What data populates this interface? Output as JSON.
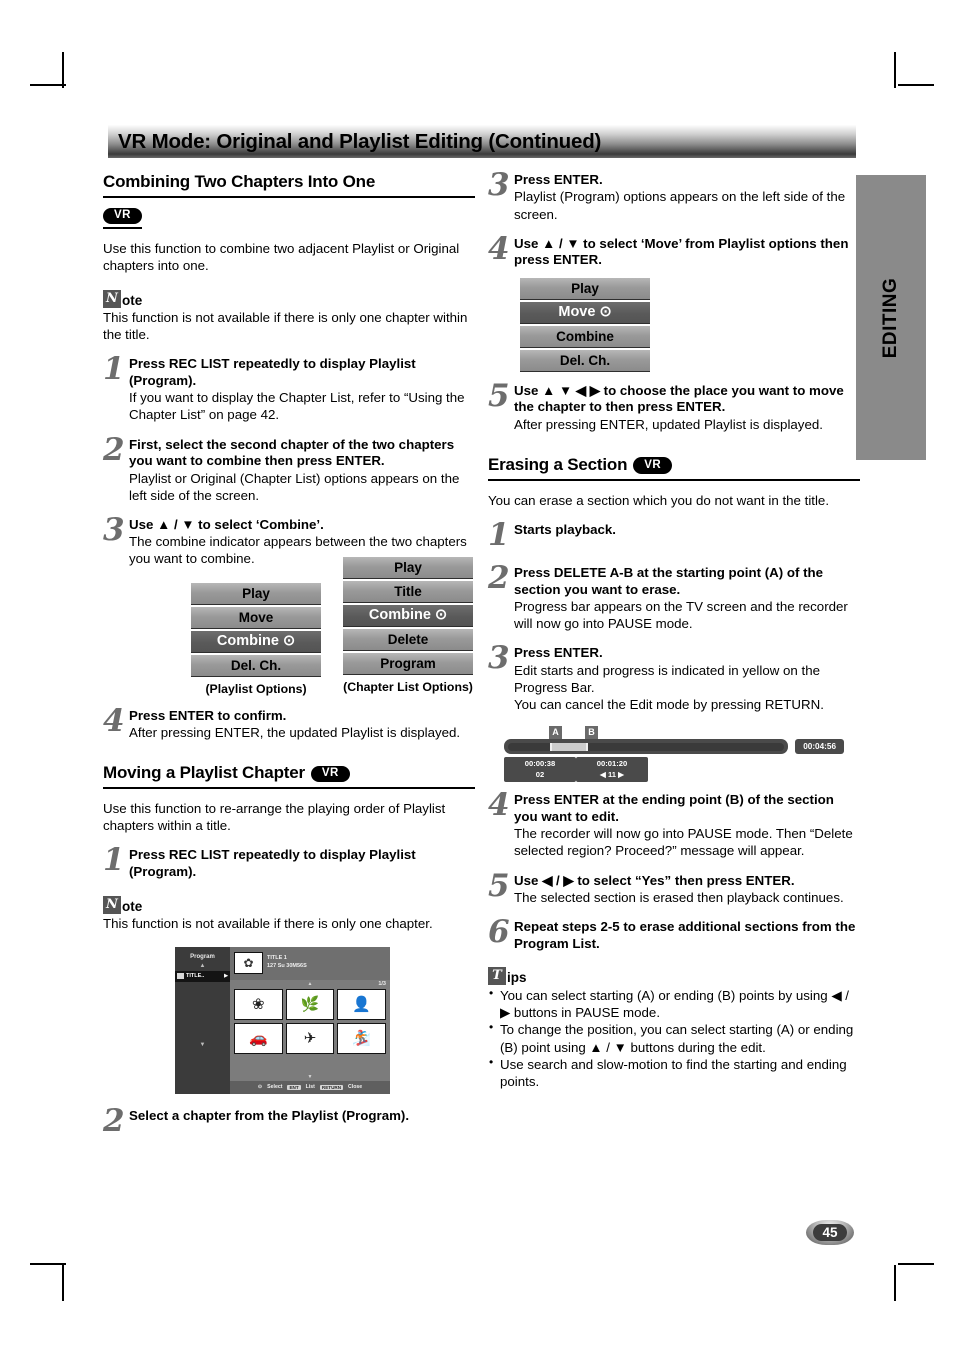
{
  "banner": {
    "title": "VR Mode: Original and Playlist Editing (Continued)"
  },
  "edge_tab": {
    "label": "EDITING"
  },
  "page_number": "45",
  "badges": {
    "vr": "VR"
  },
  "left": {
    "section1": {
      "heading": "Combining Two Chapters Into One",
      "intro": "Use this function to combine two adjacent Playlist or Original chapters into one.",
      "note": {
        "glyph": "N",
        "word": "ote",
        "body": "This function is not available if there is only one chapter within the title."
      },
      "steps": [
        {
          "num": "1",
          "bold": "Press REC LIST repeatedly to display Playlist (Program).",
          "normal": "If you want to display the Chapter List, refer to “Using the Chapter List” on page 42."
        },
        {
          "num": "2",
          "bold": "First, select the second chapter of the two chapters you want to combine then press ENTER.",
          "normal": "Playlist or Original (Chapter List) options appears on the left side of the screen."
        },
        {
          "num": "3",
          "bold": "Use ▲ / ▼ to select ‘Combine’.",
          "normal": "The combine indicator appears between the two chapters you want to combine."
        },
        {
          "num": "4",
          "bold": "Press ENTER to confirm.",
          "normal": "After pressing ENTER, the updated Playlist is displayed."
        }
      ],
      "menu_playlist": {
        "caption": "(Playlist Options)",
        "items": [
          {
            "label": "Play",
            "selected": false
          },
          {
            "label": "Move",
            "selected": false
          },
          {
            "label": "Combine ⊙",
            "selected": true
          },
          {
            "label": "Del. Ch.",
            "selected": false
          }
        ]
      },
      "menu_chapterlist": {
        "caption": "(Chapter List Options)",
        "items": [
          {
            "label": "Play",
            "selected": false
          },
          {
            "label": "Title",
            "selected": false
          },
          {
            "label": "Combine ⊙",
            "selected": true
          },
          {
            "label": "Delete",
            "selected": false
          },
          {
            "label": "Program",
            "selected": false
          }
        ]
      }
    },
    "section2": {
      "heading": "Moving a Playlist Chapter",
      "intro": "Use this function to re-arrange the playing order of Playlist chapters within a title.",
      "step1": {
        "num": "1",
        "bold": "Press REC LIST repeatedly to display Playlist (Program)."
      },
      "note": {
        "glyph": "N",
        "word": "ote",
        "body": "This function is not available if there is only one chapter."
      },
      "screenshot": {
        "panel_title": "Program",
        "up_caret": "▲",
        "down_caret": "▼",
        "title_item": "TITLE..",
        "title_item_arrow": "▶",
        "header_title": "TITLE 1",
        "header_meta": "127 Su   30M56S",
        "page_indicator": "1/3",
        "grid_caret_up": "▲",
        "grid_caret_down": "▼",
        "thumbs": [
          "❀",
          "🌿",
          "👤",
          "🚗",
          "✈",
          "🏂"
        ],
        "footer": {
          "select": "Select",
          "select_icon": "⊙",
          "list_key": "ENT",
          "list_label": "List",
          "close_key": "RETURN",
          "close_label": "Close"
        }
      },
      "step2": {
        "num": "2",
        "bold": "Select a chapter from the Playlist (Program)."
      }
    }
  },
  "right": {
    "move_steps": [
      {
        "num": "3",
        "bold": "Press ENTER.",
        "normal": "Playlist (Program) options appears on the left side of the screen."
      },
      {
        "num": "4",
        "bold": "Use ▲ / ▼ to select ‘Move’ from Playlist options then press ENTER.",
        "normal": ""
      },
      {
        "num": "5",
        "bold": "Use ▲ ▼ ◀ ▶ to choose the place you want to move the chapter to then press ENTER.",
        "normal": "After pressing ENTER, updated Playlist is displayed."
      }
    ],
    "menu_move": {
      "items": [
        {
          "label": "Play",
          "selected": false
        },
        {
          "label": "Move ⊙",
          "selected": true
        },
        {
          "label": "Combine",
          "selected": false
        },
        {
          "label": "Del. Ch.",
          "selected": false
        }
      ]
    },
    "section3": {
      "heading": "Erasing a Section",
      "intro": "You can erase a section which you do not want in the title.",
      "steps": [
        {
          "num": "1",
          "bold": "Starts playback.",
          "normal": ""
        },
        {
          "num": "2",
          "bold": "Press DELETE A-B at the starting point (A) of the section you want to erase.",
          "normal": "Progress bar appears on the TV screen and the recorder will now go into PAUSE mode."
        },
        {
          "num": "3",
          "bold": "Press ENTER.",
          "normal": "Edit starts and progress is indicated in yellow on the Progress Bar.\nYou can cancel the Edit mode by pressing RETURN."
        },
        {
          "num": "4",
          "bold": "Press ENTER at the ending point (B) of the section you want to edit.",
          "normal": "The recorder will now go into PAUSE mode. Then “Delete selected region? Proceed?” message will appear."
        },
        {
          "num": "5",
          "bold": "Use ◀ / ▶ to select “Yes” then press ENTER.",
          "normal": "The selected section is erased then playback continues."
        },
        {
          "num": "6",
          "bold": "Repeat steps 2-5 to erase additional sections from the Program List.",
          "normal": ""
        }
      ],
      "progress_figure": {
        "marker_a": "A",
        "marker_b": "B",
        "total_time": "00:04:56",
        "label_a_time": "00:00:38",
        "label_a_sub": "02",
        "label_b_time": "00:01:20",
        "label_b_sub": "◀  11  ▶"
      },
      "tips": {
        "glyph": "T",
        "word": "ips",
        "items": [
          "You can select starting (A) or ending (B) points by using ◀ / ▶ buttons in PAUSE mode.",
          "To change the position, you can select starting (A) or ending (B) point using ▲ / ▼ buttons during the edit.",
          "Use search and slow-motion to find the starting and ending points."
        ]
      }
    }
  }
}
